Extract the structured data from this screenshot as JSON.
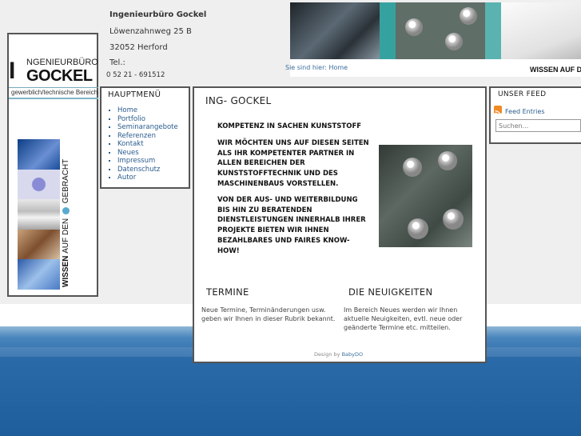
{
  "logo": {
    "letter_i": "I",
    "top_text": "NGENIEURBÜRO",
    "big_text": "GOCKEL",
    "tagline": "gewerblich/technische Bereiche",
    "vertical_text_1": "WISSEN",
    "vertical_text_2": "AUF DEN",
    "vertical_text_3": "GEBRACHT"
  },
  "contact": {
    "company": "Ingenieurbüro Gockel",
    "street": "Löwenzahnweg 25 B",
    "city": "32052 Herford",
    "tel_label": "Tel.:",
    "phone": "0 52 21 - 691512"
  },
  "header": {
    "tagline": "WISSEN AUF D"
  },
  "breadcrumb": {
    "label": "Sie sind hier:",
    "current": "Home"
  },
  "menu": {
    "title": "HAUPTMENÜ",
    "items": [
      "Home",
      "Portfolio",
      "Seminarangebote",
      "Referenzen",
      "Kontakt",
      "Neues",
      "Impressum",
      "Datenschutz",
      "Autor"
    ]
  },
  "content": {
    "title": "ING- GOCKEL",
    "heading": "KOMPETENZ IN SACHEN KUNSTSTOFF",
    "para1": "WIR MÖCHTEN UNS AUF DIESEN SEITEN ALS IHR KOMPETENTER PARTNER IN ALLEN BEREICHEN DER KUNSTSTOFFTECHNIK UND DES MASCHINENBAUS VORSTELLEN.",
    "para2": "VON DER AUS- UND WEITERBILDUNG BIS HIN ZU BERATENDEN DIENSTLEISTUNGEN INNERHALB IHRER PROJEKTE BIETEN WIR IHNEN BEZAHLBARES UND FAIRES KNOW-HOW!",
    "col_left_title": "TERMINE",
    "col_left_text": "Neue Termine, Terminänderungen usw. geben wir Ihnen in dieser Rubrik bekannt.",
    "col_right_title": "DIE NEUIGKEITEN",
    "col_right_text": "Im Bereich Neues werden wir Ihnen aktuelle Neuigkeiten, evtl. neue oder geänderte Termine etc. mitteilen.",
    "design_prefix": "Design by",
    "design_link": "BabyDO"
  },
  "feed": {
    "title": "UNSER FEED",
    "link": "Feed Entries",
    "search_placeholder": "Suchen..."
  }
}
